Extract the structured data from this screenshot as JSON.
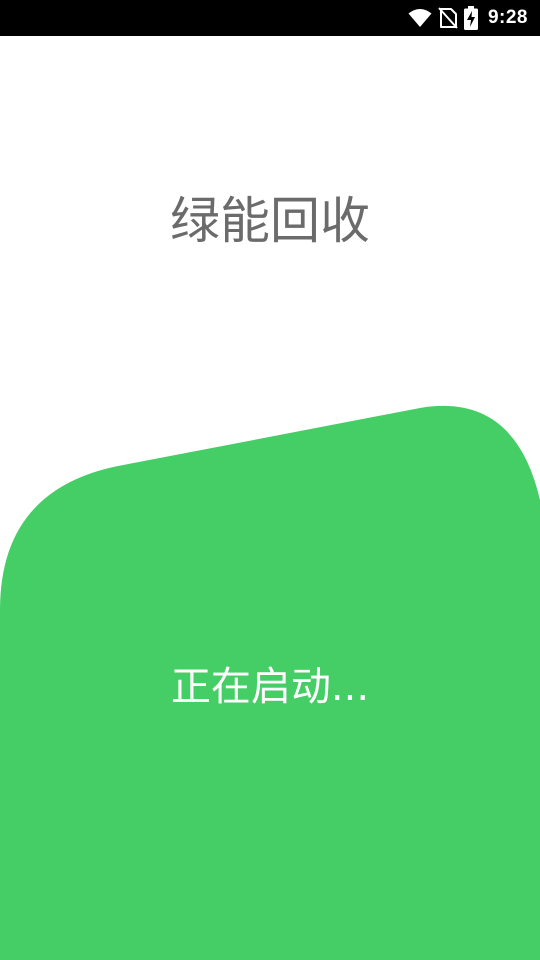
{
  "status_bar": {
    "time": "9:28",
    "icons": [
      "wifi-icon",
      "no-sim-icon",
      "battery-charging-icon"
    ]
  },
  "splash": {
    "title": "绿能回收",
    "loading_text": "正在启动..."
  },
  "colors": {
    "accent_green": "#45CE65",
    "title_gray": "#6B6B6B",
    "status_bar_bg": "#000000",
    "background": "#FFFFFF"
  }
}
